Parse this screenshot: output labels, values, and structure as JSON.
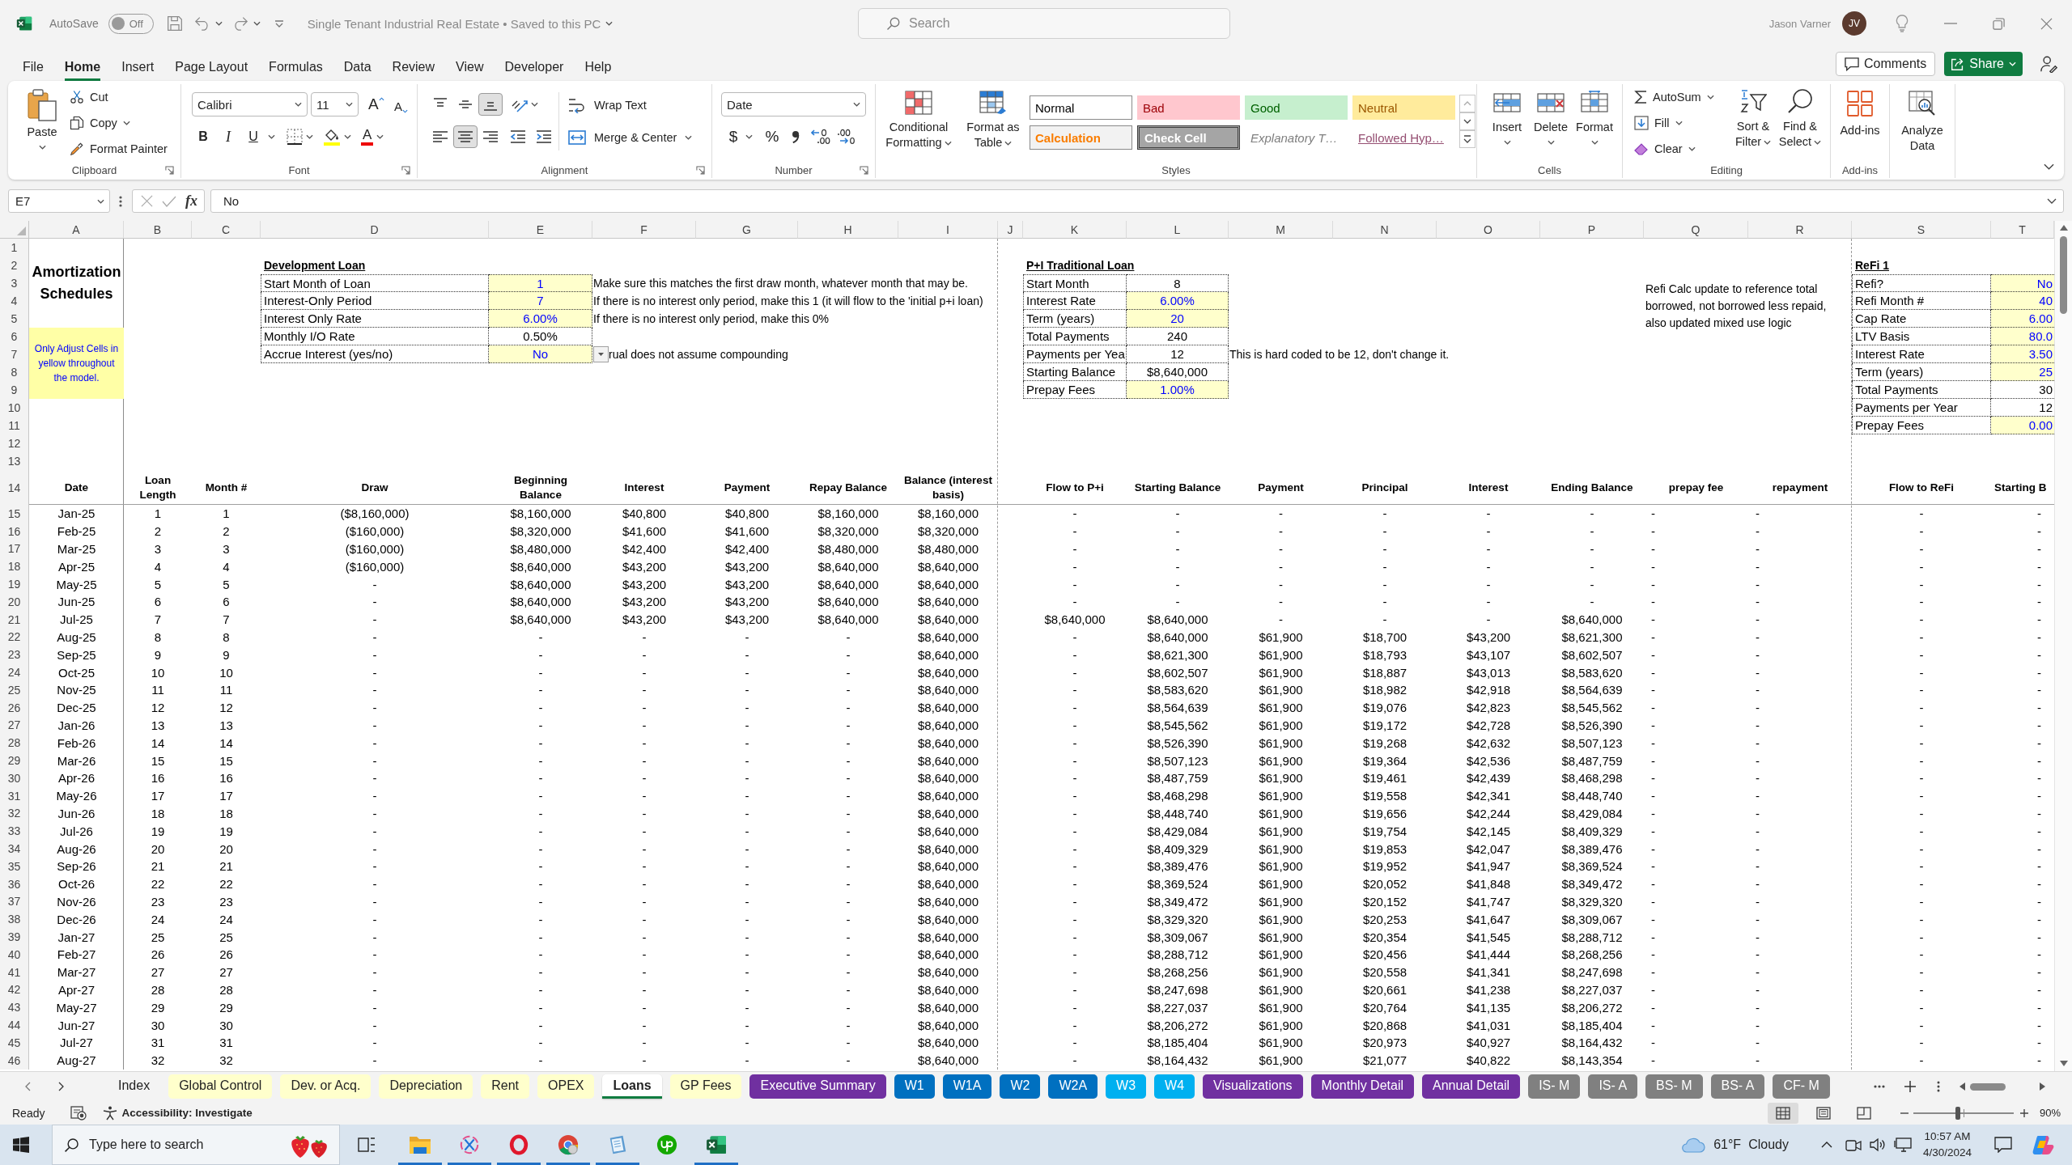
{
  "title_bar": {
    "autosave_label": "AutoSave",
    "autosave_state": "Off",
    "autosave_on": false,
    "document_title": "Single Tenant Industrial Real Estate • Saved to this PC",
    "search_placeholder": "Search",
    "user_name": "Jason Varner",
    "avatar_initials": "JV"
  },
  "menu_tabs": [
    {
      "label": "File",
      "selected": false
    },
    {
      "label": "Home",
      "selected": true
    },
    {
      "label": "Insert",
      "selected": false
    },
    {
      "label": "Page Layout",
      "selected": false
    },
    {
      "label": "Formulas",
      "selected": false
    },
    {
      "label": "Data",
      "selected": false
    },
    {
      "label": "Review",
      "selected": false
    },
    {
      "label": "View",
      "selected": false
    },
    {
      "label": "Developer",
      "selected": false
    },
    {
      "label": "Help",
      "selected": false
    }
  ],
  "comments_button": "Comments",
  "share_button": "Share",
  "ribbon": {
    "clipboard": {
      "label": "Clipboard",
      "paste": "Paste",
      "cut": "Cut",
      "copy": "Copy",
      "format_painter": "Format Painter"
    },
    "font": {
      "label": "Font",
      "font_name": "Calibri",
      "font_size": "11",
      "grow_font": "A",
      "shrink_font": "A",
      "bold": "B",
      "italic": "I",
      "underline": "U",
      "font_color": "A"
    },
    "alignment": {
      "label": "Alignment",
      "wrap_text": "Wrap Text",
      "merge_center": "Merge & Center",
      "vertical_align": [
        {
          "selected": false
        },
        {
          "selected": false
        },
        {
          "selected": true
        }
      ],
      "horizontal_align": [
        {
          "selected": false
        },
        {
          "selected": true
        },
        {
          "selected": false
        }
      ]
    },
    "number": {
      "label": "Number",
      "format": "Date",
      "currency": "$",
      "percent": "%"
    },
    "styles": {
      "label": "Styles",
      "conditional_formatting": "Conditional Formatting",
      "format_as_table": "Format as Table",
      "gallery": [
        {
          "label": "Normal",
          "kind": "normal"
        },
        {
          "label": "Bad",
          "kind": "bad"
        },
        {
          "label": "Good",
          "kind": "good"
        },
        {
          "label": "Neutral",
          "kind": "neutral"
        },
        {
          "label": "Calculation",
          "kind": "calculation"
        },
        {
          "label": "Check Cell",
          "kind": "check"
        },
        {
          "label": "Explanatory T…",
          "kind": "explanatory"
        },
        {
          "label": "Followed Hyp…",
          "kind": "followed"
        }
      ]
    },
    "cells": {
      "label": "Cells",
      "insert": "Insert",
      "delete": "Delete",
      "format": "Format"
    },
    "editing": {
      "label": "Editing",
      "autosum": "AutoSum",
      "fill": "Fill",
      "clear": "Clear",
      "sort_filter": "Sort & Filter",
      "find_select": "Find & Select"
    },
    "add_ins": {
      "label": "Add-ins",
      "button": "Add-ins"
    },
    "analyze_data": "Analyze Data"
  },
  "formula_bar": {
    "name_box": "E7",
    "function_button": "fx",
    "formula": "No"
  },
  "sheet": {
    "column_headers": [
      "A",
      "B",
      "C",
      "D",
      "E",
      "F",
      "G",
      "H",
      "I",
      "J",
      "K",
      "L",
      "M",
      "N",
      "O",
      "P",
      "Q",
      "R",
      "S",
      "T"
    ],
    "row_numbers": [
      "1",
      "2",
      "3",
      "4",
      "5",
      "6",
      "7",
      "8",
      "9",
      "10",
      "11",
      "12",
      "13",
      "14",
      "15",
      "16",
      "17",
      "18",
      "19",
      "20",
      "21",
      "22",
      "23",
      "24",
      "25",
      "26",
      "27",
      "28",
      "29",
      "30",
      "31",
      "32",
      "33",
      "34",
      "35",
      "36",
      "37",
      "38",
      "39",
      "40",
      "41",
      "42",
      "43",
      "44",
      "45",
      "46"
    ],
    "title": "Amortization Schedules",
    "instruction": "Only Adjust Cells in yellow throughout the model.",
    "development_loan": {
      "title": "Development Loan",
      "rows": [
        {
          "label": "Start Month of Loan",
          "value": "1",
          "input": true,
          "dropdown": false,
          "note": "Make sure this matches the first draw month, whatever month that may be."
        },
        {
          "label": "Interest-Only Period",
          "value": "7",
          "input": true,
          "dropdown": false,
          "note": "If there is no interest only period, make this 1 (it will flow to the 'initial p+i loan)"
        },
        {
          "label": "Interest Only Rate",
          "value": "6.00%",
          "input": true,
          "dropdown": false,
          "note": "If there is no interest only period, make this 0%"
        },
        {
          "label": "Monthly I/O Rate",
          "value": "0.50%",
          "input": false,
          "dropdown": false
        },
        {
          "label": "Accrue Interest (yes/no)",
          "value": "No",
          "input": true,
          "dropdown": true,
          "note": "rual does not assume compounding"
        }
      ]
    },
    "traditional_loan": {
      "title": "P+I Traditional Loan",
      "rows": [
        {
          "label": "Start Month",
          "value": "8",
          "input": false
        },
        {
          "label": "Interest Rate",
          "value": "6.00%",
          "input": true
        },
        {
          "label": "Term (years)",
          "value": "20",
          "input": true
        },
        {
          "label": "Total Payments",
          "value": "240",
          "input": false
        },
        {
          "label": "Payments per Yea",
          "value": "12",
          "input": false,
          "note": "This is hard coded to be 12, don't change it."
        },
        {
          "label": "Starting Balance",
          "value": "$8,640,000",
          "input": false
        },
        {
          "label": "Prepay Fees",
          "value": "1.00%",
          "input": true
        }
      ]
    },
    "refi_note": "Refi Calc update to reference total borrowed, not borrowed less repaid, also updated mixed use logic",
    "refi": {
      "title": "ReFi 1",
      "rows": [
        {
          "label": "Refi?",
          "value": "No",
          "input": true
        },
        {
          "label": "Refi Month #",
          "value": "40",
          "input": true
        },
        {
          "label": "Cap Rate",
          "value": "6.00",
          "input": true
        },
        {
          "label": "LTV Basis",
          "value": "80.0",
          "input": true
        },
        {
          "label": "Interest Rate",
          "value": "3.50",
          "input": true
        },
        {
          "label": "Term (years)",
          "value": "25",
          "input": true
        },
        {
          "label": "Total Payments",
          "value": "30",
          "input": false
        },
        {
          "label": "Payments per Year",
          "value": "12",
          "input": false
        },
        {
          "label": "Prepay Fees",
          "value": "0.00",
          "input": true
        }
      ]
    },
    "schedule": {
      "columns": [
        "Date",
        "Loan Length",
        "Month #",
        "Draw",
        "Beginning Balance",
        "Interest",
        "Payment",
        "Repay Balance",
        "Balance (interest basis)",
        "Flow to P+i",
        "Starting Balance",
        "Payment",
        "Principal",
        "Interest",
        "Ending Balance",
        "prepay fee",
        "repayment",
        "Flow to ReFi",
        "Starting B"
      ],
      "rows": [
        [
          "Jan-25",
          "1",
          "1",
          "($8,160,000)",
          "$8,160,000",
          "$40,800",
          "$40,800",
          "$8,160,000",
          "$8,160,000",
          "-",
          "-",
          "-",
          "-",
          "-",
          "-",
          "-",
          "-",
          "-",
          "-"
        ],
        [
          "Feb-25",
          "2",
          "2",
          "($160,000)",
          "$8,320,000",
          "$41,600",
          "$41,600",
          "$8,320,000",
          "$8,320,000",
          "-",
          "-",
          "-",
          "-",
          "-",
          "-",
          "-",
          "-",
          "-",
          "-"
        ],
        [
          "Mar-25",
          "3",
          "3",
          "($160,000)",
          "$8,480,000",
          "$42,400",
          "$42,400",
          "$8,480,000",
          "$8,480,000",
          "-",
          "-",
          "-",
          "-",
          "-",
          "-",
          "-",
          "-",
          "-",
          "-"
        ],
        [
          "Apr-25",
          "4",
          "4",
          "($160,000)",
          "$8,640,000",
          "$43,200",
          "$43,200",
          "$8,640,000",
          "$8,640,000",
          "-",
          "-",
          "-",
          "-",
          "-",
          "-",
          "-",
          "-",
          "-",
          "-"
        ],
        [
          "May-25",
          "5",
          "5",
          "-",
          "$8,640,000",
          "$43,200",
          "$43,200",
          "$8,640,000",
          "$8,640,000",
          "-",
          "-",
          "-",
          "-",
          "-",
          "-",
          "-",
          "-",
          "-",
          "-"
        ],
        [
          "Jun-25",
          "6",
          "6",
          "-",
          "$8,640,000",
          "$43,200",
          "$43,200",
          "$8,640,000",
          "$8,640,000",
          "-",
          "-",
          "-",
          "-",
          "-",
          "-",
          "-",
          "-",
          "-",
          "-"
        ],
        [
          "Jul-25",
          "7",
          "7",
          "-",
          "$8,640,000",
          "$43,200",
          "$43,200",
          "$8,640,000",
          "$8,640,000",
          "$8,640,000",
          "$8,640,000",
          "-",
          "-",
          "-",
          "$8,640,000",
          "-",
          "-",
          "-",
          "-"
        ],
        [
          "Aug-25",
          "8",
          "8",
          "-",
          "-",
          "-",
          "-",
          "-",
          "$8,640,000",
          "-",
          "$8,640,000",
          "$61,900",
          "$18,700",
          "$43,200",
          "$8,621,300",
          "-",
          "-",
          "-",
          "-"
        ],
        [
          "Sep-25",
          "9",
          "9",
          "-",
          "-",
          "-",
          "-",
          "-",
          "$8,640,000",
          "-",
          "$8,621,300",
          "$61,900",
          "$18,793",
          "$43,107",
          "$8,602,507",
          "-",
          "-",
          "-",
          "-"
        ],
        [
          "Oct-25",
          "10",
          "10",
          "-",
          "-",
          "-",
          "-",
          "-",
          "$8,640,000",
          "-",
          "$8,602,507",
          "$61,900",
          "$18,887",
          "$43,013",
          "$8,583,620",
          "-",
          "-",
          "-",
          "-"
        ],
        [
          "Nov-25",
          "11",
          "11",
          "-",
          "-",
          "-",
          "-",
          "-",
          "$8,640,000",
          "-",
          "$8,583,620",
          "$61,900",
          "$18,982",
          "$42,918",
          "$8,564,639",
          "-",
          "-",
          "-",
          "-"
        ],
        [
          "Dec-25",
          "12",
          "12",
          "-",
          "-",
          "-",
          "-",
          "-",
          "$8,640,000",
          "-",
          "$8,564,639",
          "$61,900",
          "$19,076",
          "$42,823",
          "$8,545,562",
          "-",
          "-",
          "-",
          "-"
        ],
        [
          "Jan-26",
          "13",
          "13",
          "-",
          "-",
          "-",
          "-",
          "-",
          "$8,640,000",
          "-",
          "$8,545,562",
          "$61,900",
          "$19,172",
          "$42,728",
          "$8,526,390",
          "-",
          "-",
          "-",
          "-"
        ],
        [
          "Feb-26",
          "14",
          "14",
          "-",
          "-",
          "-",
          "-",
          "-",
          "$8,640,000",
          "-",
          "$8,526,390",
          "$61,900",
          "$19,268",
          "$42,632",
          "$8,507,123",
          "-",
          "-",
          "-",
          "-"
        ],
        [
          "Mar-26",
          "15",
          "15",
          "-",
          "-",
          "-",
          "-",
          "-",
          "$8,640,000",
          "-",
          "$8,507,123",
          "$61,900",
          "$19,364",
          "$42,536",
          "$8,487,759",
          "-",
          "-",
          "-",
          "-"
        ],
        [
          "Apr-26",
          "16",
          "16",
          "-",
          "-",
          "-",
          "-",
          "-",
          "$8,640,000",
          "-",
          "$8,487,759",
          "$61,900",
          "$19,461",
          "$42,439",
          "$8,468,298",
          "-",
          "-",
          "-",
          "-"
        ],
        [
          "May-26",
          "17",
          "17",
          "-",
          "-",
          "-",
          "-",
          "-",
          "$8,640,000",
          "-",
          "$8,468,298",
          "$61,900",
          "$19,558",
          "$42,341",
          "$8,448,740",
          "-",
          "-",
          "-",
          "-"
        ],
        [
          "Jun-26",
          "18",
          "18",
          "-",
          "-",
          "-",
          "-",
          "-",
          "$8,640,000",
          "-",
          "$8,448,740",
          "$61,900",
          "$19,656",
          "$42,244",
          "$8,429,084",
          "-",
          "-",
          "-",
          "-"
        ],
        [
          "Jul-26",
          "19",
          "19",
          "-",
          "-",
          "-",
          "-",
          "-",
          "$8,640,000",
          "-",
          "$8,429,084",
          "$61,900",
          "$19,754",
          "$42,145",
          "$8,409,329",
          "-",
          "-",
          "-",
          "-"
        ],
        [
          "Aug-26",
          "20",
          "20",
          "-",
          "-",
          "-",
          "-",
          "-",
          "$8,640,000",
          "-",
          "$8,409,329",
          "$61,900",
          "$19,853",
          "$42,047",
          "$8,389,476",
          "-",
          "-",
          "-",
          "-"
        ],
        [
          "Sep-26",
          "21",
          "21",
          "-",
          "-",
          "-",
          "-",
          "-",
          "$8,640,000",
          "-",
          "$8,389,476",
          "$61,900",
          "$19,952",
          "$41,947",
          "$8,369,524",
          "-",
          "-",
          "-",
          "-"
        ],
        [
          "Oct-26",
          "22",
          "22",
          "-",
          "-",
          "-",
          "-",
          "-",
          "$8,640,000",
          "-",
          "$8,369,524",
          "$61,900",
          "$20,052",
          "$41,848",
          "$8,349,472",
          "-",
          "-",
          "-",
          "-"
        ],
        [
          "Nov-26",
          "23",
          "23",
          "-",
          "-",
          "-",
          "-",
          "-",
          "$8,640,000",
          "-",
          "$8,349,472",
          "$61,900",
          "$20,152",
          "$41,747",
          "$8,329,320",
          "-",
          "-",
          "-",
          "-"
        ],
        [
          "Dec-26",
          "24",
          "24",
          "-",
          "-",
          "-",
          "-",
          "-",
          "$8,640,000",
          "-",
          "$8,329,320",
          "$61,900",
          "$20,253",
          "$41,647",
          "$8,309,067",
          "-",
          "-",
          "-",
          "-"
        ],
        [
          "Jan-27",
          "25",
          "25",
          "-",
          "-",
          "-",
          "-",
          "-",
          "$8,640,000",
          "-",
          "$8,309,067",
          "$61,900",
          "$20,354",
          "$41,545",
          "$8,288,712",
          "-",
          "-",
          "-",
          "-"
        ],
        [
          "Feb-27",
          "26",
          "26",
          "-",
          "-",
          "-",
          "-",
          "-",
          "$8,640,000",
          "-",
          "$8,288,712",
          "$61,900",
          "$20,456",
          "$41,444",
          "$8,268,256",
          "-",
          "-",
          "-",
          "-"
        ],
        [
          "Mar-27",
          "27",
          "27",
          "-",
          "-",
          "-",
          "-",
          "-",
          "$8,640,000",
          "-",
          "$8,268,256",
          "$61,900",
          "$20,558",
          "$41,341",
          "$8,247,698",
          "-",
          "-",
          "-",
          "-"
        ],
        [
          "Apr-27",
          "28",
          "28",
          "-",
          "-",
          "-",
          "-",
          "-",
          "$8,640,000",
          "-",
          "$8,247,698",
          "$61,900",
          "$20,661",
          "$41,238",
          "$8,227,037",
          "-",
          "-",
          "-",
          "-"
        ],
        [
          "May-27",
          "29",
          "29",
          "-",
          "-",
          "-",
          "-",
          "-",
          "$8,640,000",
          "-",
          "$8,227,037",
          "$61,900",
          "$20,764",
          "$41,135",
          "$8,206,272",
          "-",
          "-",
          "-",
          "-"
        ],
        [
          "Jun-27",
          "30",
          "30",
          "-",
          "-",
          "-",
          "-",
          "-",
          "$8,640,000",
          "-",
          "$8,206,272",
          "$61,900",
          "$20,868",
          "$41,031",
          "$8,185,404",
          "-",
          "-",
          "-",
          "-"
        ],
        [
          "Jul-27",
          "31",
          "31",
          "-",
          "-",
          "-",
          "-",
          "-",
          "$8,640,000",
          "-",
          "$8,185,404",
          "$61,900",
          "$20,973",
          "$40,927",
          "$8,164,432",
          "-",
          "-",
          "-",
          "-"
        ],
        [
          "Aug-27",
          "32",
          "32",
          "-",
          "-",
          "-",
          "-",
          "-",
          "$8,640,000",
          "-",
          "$8,164,432",
          "$61,900",
          "$21,077",
          "$40,822",
          "$8,143,354",
          "-",
          "-",
          "-",
          "-"
        ]
      ]
    }
  },
  "sheet_tabs": [
    {
      "label": "Index",
      "selected": false
    },
    {
      "label": "Global Control",
      "selected": false,
      "color": "#ffffcc"
    },
    {
      "label": "Dev. or Acq.",
      "selected": false,
      "color": "#ffffcc"
    },
    {
      "label": "Depreciation",
      "selected": false,
      "color": "#ffffcc"
    },
    {
      "label": "Rent",
      "selected": false,
      "color": "#ffffcc"
    },
    {
      "label": "OPEX",
      "selected": false,
      "color": "#ffffcc"
    },
    {
      "label": "Loans",
      "selected": true
    },
    {
      "label": "GP Fees",
      "selected": false,
      "color": "#ffffcc"
    },
    {
      "label": "Executive Summary",
      "selected": false,
      "color": "#7030a0"
    },
    {
      "label": "W1",
      "selected": false,
      "color": "#0070c0"
    },
    {
      "label": "W1A",
      "selected": false,
      "color": "#0070c0"
    },
    {
      "label": "W2",
      "selected": false,
      "color": "#0070c0"
    },
    {
      "label": "W2A",
      "selected": false,
      "color": "#0070c0"
    },
    {
      "label": "W3",
      "selected": false,
      "color": "#00b0f0"
    },
    {
      "label": "W4",
      "selected": false,
      "color": "#00b0f0"
    },
    {
      "label": "Visualizations",
      "selected": false,
      "color": "#7030a0"
    },
    {
      "label": "Monthly Detail",
      "selected": false,
      "color": "#7030a0"
    },
    {
      "label": "Annual Detail",
      "selected": false,
      "color": "#7030a0"
    },
    {
      "label": "IS- M",
      "selected": false,
      "color": "#808080"
    },
    {
      "label": "IS- A",
      "selected": false,
      "color": "#808080"
    },
    {
      "label": "BS- M",
      "selected": false,
      "color": "#808080"
    },
    {
      "label": "BS- A",
      "selected": false,
      "color": "#808080"
    },
    {
      "label": "CF- M",
      "selected": false,
      "color": "#808080"
    }
  ],
  "status_bar": {
    "status": "Ready",
    "accessibility": "Accessibility: Investigate",
    "views": [
      {
        "selected": true
      },
      {
        "selected": false
      },
      {
        "selected": false
      }
    ],
    "zoom": {
      "level": 0.44,
      "reading": "90%"
    }
  },
  "taskbar": {
    "search_placeholder": "Type here to search",
    "apps": [
      {
        "running": true
      },
      {
        "running": true
      },
      {
        "running": true
      },
      {
        "running": true
      },
      {
        "running": true
      },
      {
        "running": false
      },
      {
        "running": true
      }
    ],
    "temperature": "61°F",
    "weather": "Cloudy",
    "time": "10:57 AM",
    "date": "4/30/2024"
  }
}
